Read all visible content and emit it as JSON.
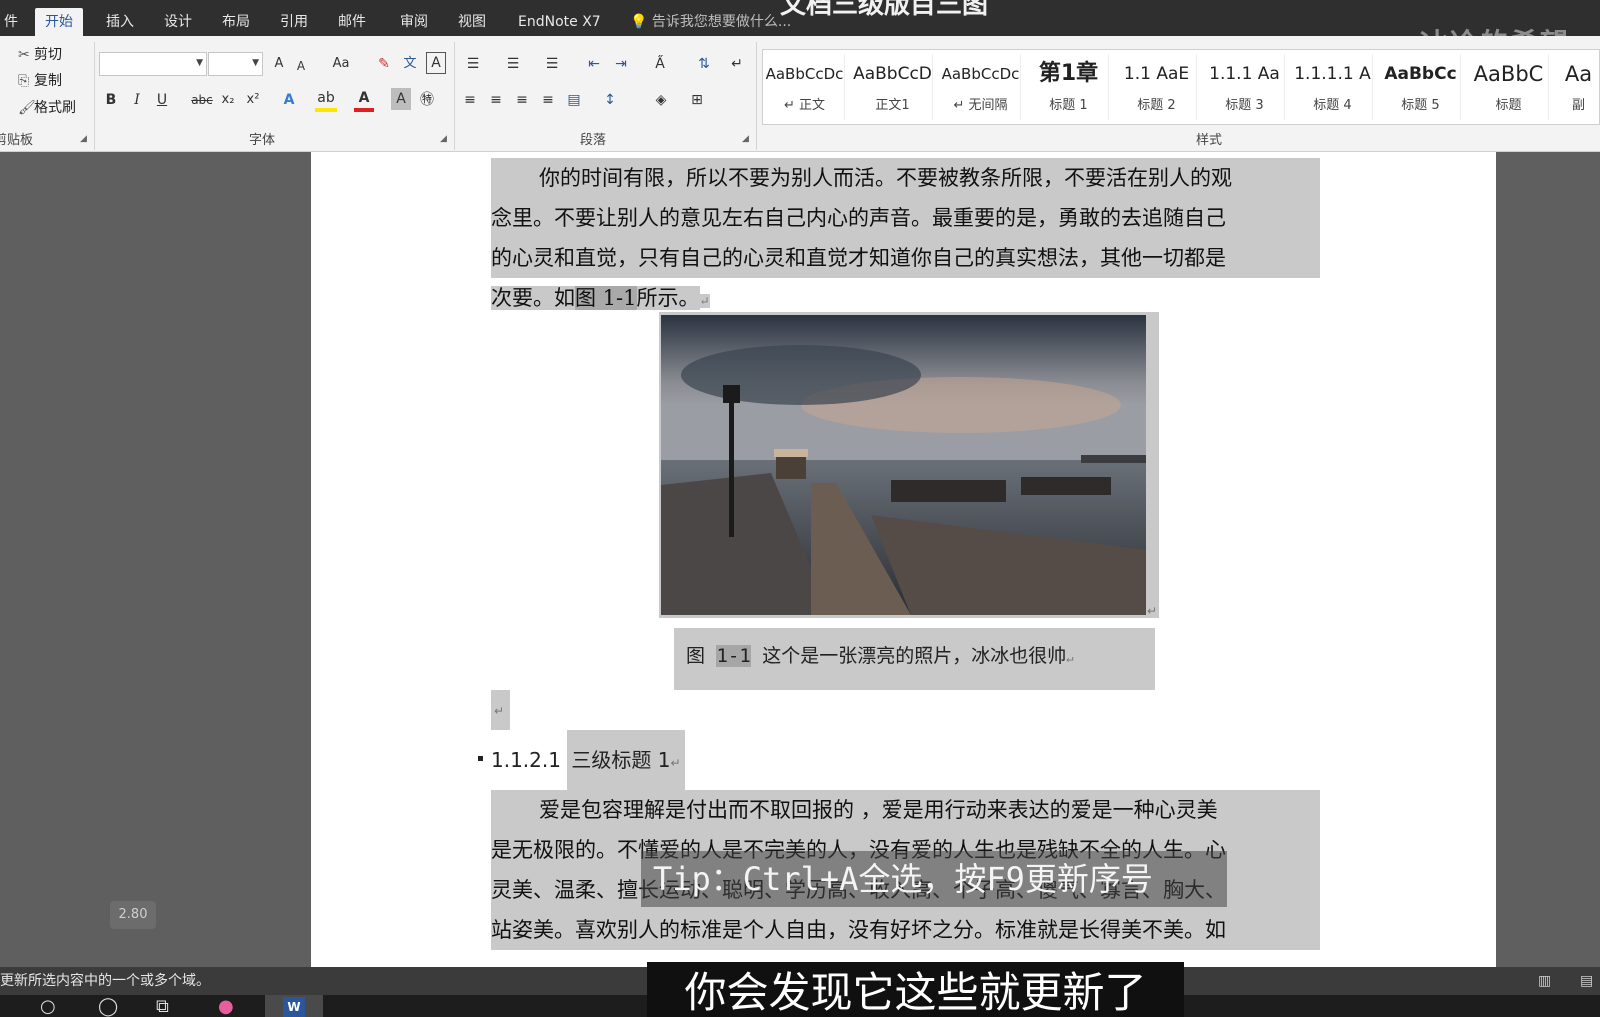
{
  "ribbon_tabs": [
    {
      "label": "件",
      "active": false
    },
    {
      "label": "开始",
      "active": true
    },
    {
      "label": "插入",
      "active": false
    },
    {
      "label": "设计",
      "active": false
    },
    {
      "label": "布局",
      "active": false
    },
    {
      "label": "引用",
      "active": false
    },
    {
      "label": "邮件",
      "active": false
    },
    {
      "label": "审阅",
      "active": false
    },
    {
      "label": "视图",
      "active": false
    },
    {
      "label": "EndNote X7",
      "active": false
    }
  ],
  "tell_me": "告诉我您想要做什么...",
  "doc_title_fragment": "文档三级版目三图",
  "watermark": "冰冷的希望",
  "clipboard": {
    "cut": "剪切",
    "copy": "复制",
    "format_painter": "格式刷",
    "group_label": "剪贴板"
  },
  "font_group": {
    "font_name": "",
    "font_size": "",
    "grow": "A",
    "shrink": "A",
    "case": "Aa",
    "bold": "B",
    "italic": "I",
    "underline": "U",
    "strike": "abc",
    "subscript": "x₂",
    "superscript": "x²",
    "label": "字体"
  },
  "paragraph_group": {
    "label": "段落"
  },
  "styles": {
    "label": "样式",
    "items": [
      {
        "sample": "AaBbCcDc",
        "name": "正文"
      },
      {
        "sample": "AaBbCcD",
        "name": "正文1"
      },
      {
        "sample": "AaBbCcDc",
        "name": "无间隔"
      },
      {
        "sample": "第1章",
        "name": "标题 1"
      },
      {
        "sample": "1.1 AaE",
        "name": "标题 2"
      },
      {
        "sample": "1.1.1 Aa",
        "name": "标题 3"
      },
      {
        "sample": "1.1.1.1 A",
        "name": "标题 4"
      },
      {
        "sample": "AaBbCc",
        "name": "标题 5"
      },
      {
        "sample": "AaBbC",
        "name": "标题"
      },
      {
        "sample": "Aa",
        "name": "副"
      }
    ]
  },
  "document": {
    "para1_lines": [
      "你的时间有限，所以不要为别人而活。不要被教条所限，不要活在别人的观",
      "念里。不要让别人的意见左右自己内心的声音。最重要的是，勇敢的去追随自己",
      "的心灵和直觉，只有自己的心灵和直觉才知道你自己的真实想法，其他一切都是"
    ],
    "para1_last_before": "次要。如",
    "para1_ref": "图 1-1",
    "para1_last_after": "所示。",
    "caption_prefix": "图 ",
    "caption_number": "1-1",
    "caption_text": " 这个是一张漂亮的照片，冰冰也很帅",
    "heading_number": "1.1.2.1",
    "heading_text": "三级标题 1",
    "para2_lines": [
      "爱是包容理解是付出而不取回报的 ，爱是用行动来表达的爱是一种心灵美",
      "是无极限的。不懂爱的人是不完美的人，没有爱的人生也是残缺不全的人生。心",
      "灵美、温柔、擅长运动、聪明、学历高、收入高、个子高、傻气、寡言、胸大、",
      "站姿美。喜欢别人的标准是个人自由，没有好坏之分。标准就是长得美不美。如"
    ],
    "paragraph_mark": "↵"
  },
  "zoom_badge": "2.80",
  "tip_overlay": "Tip：Ctrl+A全选，按F9更新序号",
  "status_text": "更新所选内容中的一个或多个域。",
  "subtitle": "你会发现它这些就更新了"
}
